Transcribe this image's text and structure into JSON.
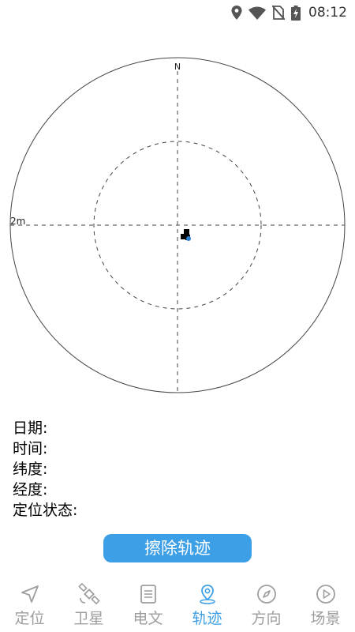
{
  "status_bar": {
    "time": "08:12",
    "icons": [
      "location-icon",
      "wifi-icon",
      "no-sim-icon",
      "battery-charging-icon"
    ]
  },
  "radar": {
    "north_label": "N",
    "scale_label": "2m"
  },
  "info": {
    "date_label": "日期:",
    "time_label": "时间:",
    "latitude_label": "纬度:",
    "longitude_label": "经度:",
    "fix_status_label": "定位状态:"
  },
  "actions": {
    "clear_track_label": "擦除轨迹"
  },
  "nav": {
    "active": "轨迹",
    "items": [
      {
        "label": "定位",
        "icon": "navigation-arrow-icon"
      },
      {
        "label": "卫星",
        "icon": "satellite-icon"
      },
      {
        "label": "电文",
        "icon": "document-icon"
      },
      {
        "label": "轨迹",
        "icon": "map-pin-icon"
      },
      {
        "label": "方向",
        "icon": "compass-icon"
      },
      {
        "label": "场景",
        "icon": "play-circle-icon"
      }
    ]
  },
  "colors": {
    "accent": "#3d9fe6",
    "inactive": "#9e9e9e",
    "track_point": "#000000",
    "current_position": "#2b7fd1"
  }
}
